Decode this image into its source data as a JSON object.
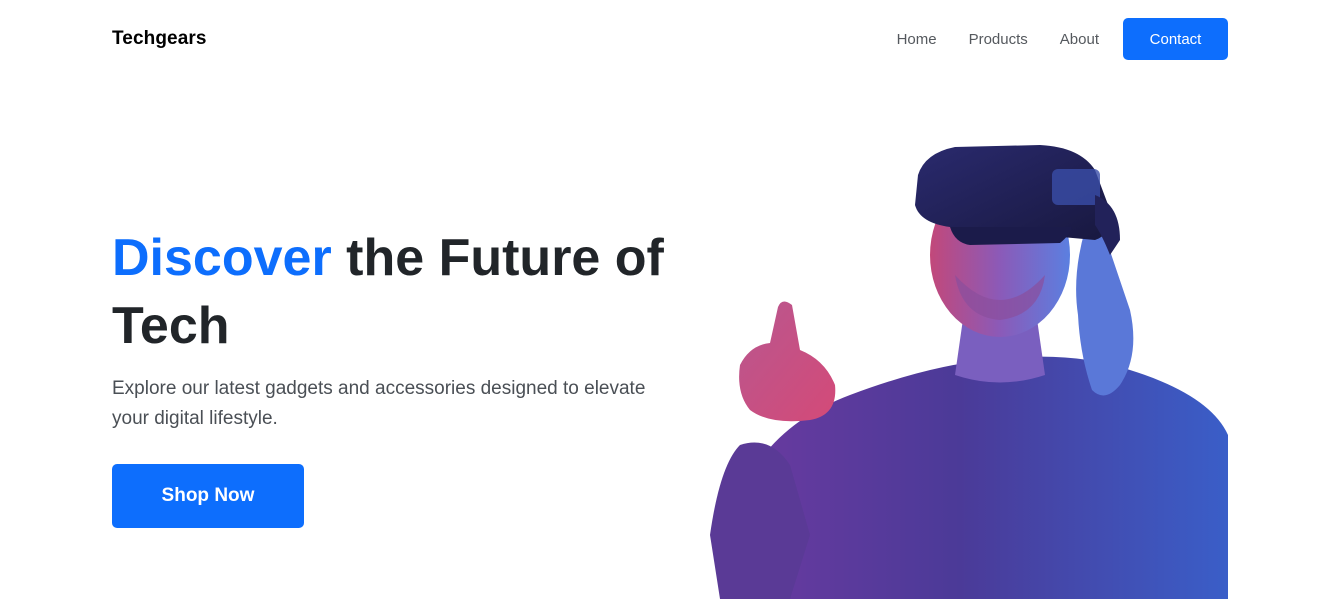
{
  "brand": "Techgears",
  "nav": {
    "links": [
      "Home",
      "Products",
      "About"
    ],
    "contact_label": "Contact"
  },
  "hero": {
    "title_accent": "Discover",
    "title_rest": " the Future of Tech",
    "subtitle": "Explore our latest gadgets and accessories designed to elevate your digital lifestyle.",
    "cta_label": "Shop Now",
    "image_icon": "vr-headset-person-icon"
  },
  "colors": {
    "primary": "#0d6efd",
    "text": "#212529",
    "background": "#ffffff"
  }
}
